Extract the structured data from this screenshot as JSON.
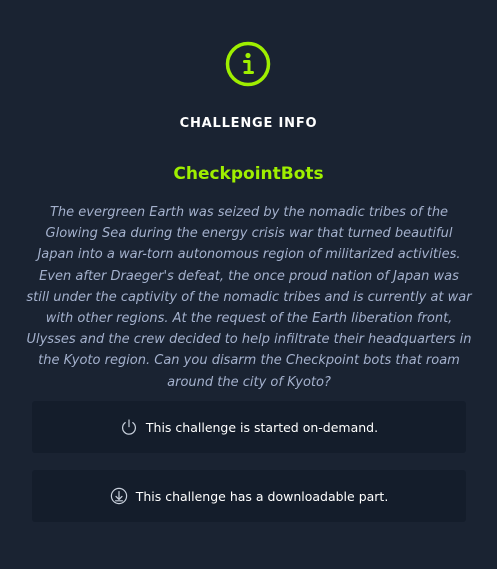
{
  "modal": {
    "title": "CHALLENGE INFO",
    "challenge_name": "CheckpointBots",
    "description": "The evergreen Earth was seized by the nomadic tribes of the Glowing Sea during the energy crisis war that turned beautiful Japan into a war-torn autonomous region of militarized activities. Even after Draeger's defeat, the once proud nation of Japan was still under the captivity of the nomadic tribes and is currently at war with other regions. At the request of the Earth liberation front, Ulysses and the crew decided to help infiltrate their headquarters in the Kyoto region. Can you disarm the Checkpoint bots that roam around the city of Kyoto?",
    "icon": "info-icon"
  },
  "features": [
    {
      "icon": "power-icon",
      "label": "This challenge is started on-demand."
    },
    {
      "icon": "download-icon",
      "label": "This challenge has a downloadable part."
    }
  ],
  "colors": {
    "background": "#1a2332",
    "panel": "#141d2b",
    "accent": "#9fef00",
    "text_primary": "#ffffff",
    "text_muted": "#a4b1cd"
  }
}
